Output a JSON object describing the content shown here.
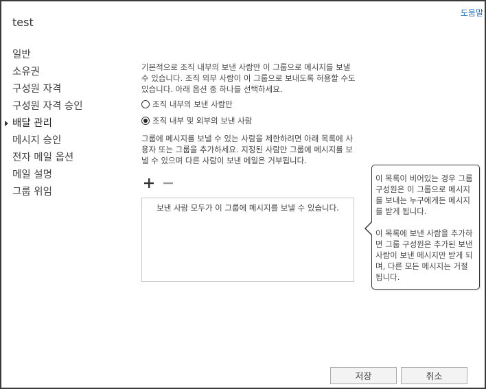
{
  "header": {
    "help_link": "도움말",
    "title": "test"
  },
  "nav": {
    "items": [
      {
        "label": "일반",
        "selected": false
      },
      {
        "label": "소유권",
        "selected": false
      },
      {
        "label": "구성원 자격",
        "selected": false
      },
      {
        "label": "구성원 자격 승인",
        "selected": false
      },
      {
        "label": "배달 관리",
        "selected": true
      },
      {
        "label": "메시지 승인",
        "selected": false
      },
      {
        "label": "전자 메일 옵션",
        "selected": false
      },
      {
        "label": "메일 설명",
        "selected": false
      },
      {
        "label": "그룹 위임",
        "selected": false
      }
    ]
  },
  "delivery": {
    "description": "기본적으로 조직 내부의 보낸 사람만 이 그룹으로 메시지를 보낼 수 있습니다. 조직 외부 사람이 이 그룹으로 보내도록 허용할 수도 있습니다. 아래 옵션 중 하나를 선택하세요.",
    "options": [
      {
        "label": "조직 내부의 보낸 사람만",
        "checked": false
      },
      {
        "label": "조직 내부 및 외부의 보낸 사람",
        "checked": true
      }
    ],
    "restrict_text": "그룹에 메시지를 보낼 수 있는 사람을 제한하려면 아래 목록에 사용자 또는 그룹을 추가하세요. 지정된 사람만 그룹에 메시지를 보낼 수 있으며 다른 사람이 보낸 메일은 거부됩니다.",
    "add_icon": "plus-icon",
    "remove_icon": "minus-icon",
    "senders_empty": "보낸 사람 모두가 이 그룹에 메시지를 보낼 수 있습니다."
  },
  "tooltip": {
    "paragraph1": "이 목록이 비어있는 경우 그룹 구성원은 이 그룹으로 메시지를 보내는 누구에게든 메시지를 받게 됩니다.",
    "paragraph2": "이 목록에 보낸 사람을 추가하면 그룹 구성원은 추가된 보낸 사람이 보낸 메시지만 받게 되며, 다른 모든 메시지는 거절됩니다."
  },
  "footer": {
    "save_label": "저장",
    "cancel_label": "취소"
  },
  "colors": {
    "link": "#1e6fb8",
    "border": "#3a3a3a"
  }
}
